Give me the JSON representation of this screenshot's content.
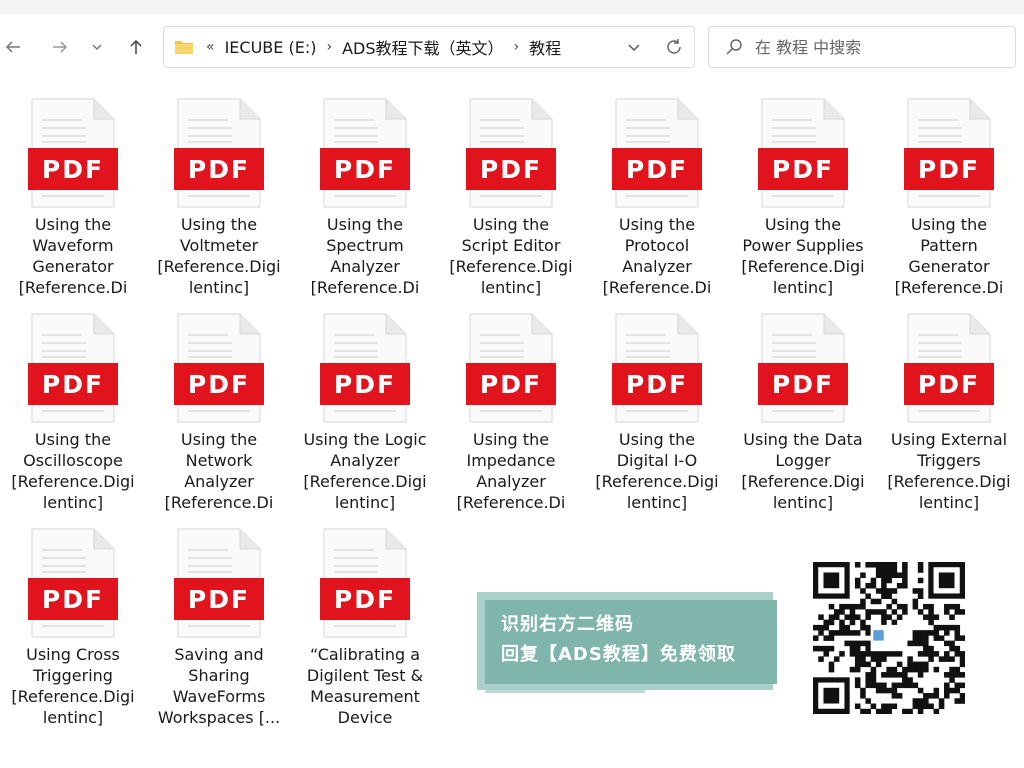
{
  "nav": {
    "back_icon": "arrow-left-icon",
    "forward_icon": "arrow-right-icon",
    "recent_icon": "chevron-down-icon",
    "up_icon": "arrow-up-icon"
  },
  "address": {
    "overflow": "«",
    "crumbs": [
      "IECUBE (E:)",
      "ADS教程下载（英文）",
      "教程"
    ],
    "separator": "›"
  },
  "search": {
    "placeholder": "在 教程 中搜索"
  },
  "colors": {
    "pdf_red": "#e1131d",
    "promo_green": "#7fb5aa"
  },
  "files": [
    {
      "label": "Using the Waveform Generator [Reference.Di…"
    },
    {
      "label": "Using the Voltmeter [Reference.Digilentinc]"
    },
    {
      "label": "Using the Spectrum Analyzer [Reference.Di…"
    },
    {
      "label": "Using the Script Editor [Reference.Digilentinc]"
    },
    {
      "label": "Using the Protocol Analyzer [Reference.Di…"
    },
    {
      "label": "Using the Power Supplies [Reference.Digilentinc]"
    },
    {
      "label": "Using the Pattern Generator [Reference.Di…"
    },
    {
      "label": "Using the Oscilloscope [Reference.Digilentinc]"
    },
    {
      "label": "Using the Network Analyzer [Reference.Di…"
    },
    {
      "label": "Using the Logic Analyzer [Reference.Digilentinc]"
    },
    {
      "label": "Using the Impedance Analyzer [Reference.Di…"
    },
    {
      "label": "Using the Digital I-O [Reference.Digilentinc]"
    },
    {
      "label": "Using the Data Logger [Reference.Digilentinc]"
    },
    {
      "label": "Using External Triggers [Reference.Digilentinc]"
    },
    {
      "label": "Using Cross Triggering [Reference.Digilentinc]"
    },
    {
      "label": "Saving and Sharing WaveForms Workspaces [..."
    },
    {
      "label": "“Calibrating a Digilent Test & Measurement Device [Refer…"
    }
  ],
  "pdf_text": "PDF",
  "promo": {
    "line1": "识别右方二维码",
    "line2": "回复【ADS教程】免费领取"
  }
}
